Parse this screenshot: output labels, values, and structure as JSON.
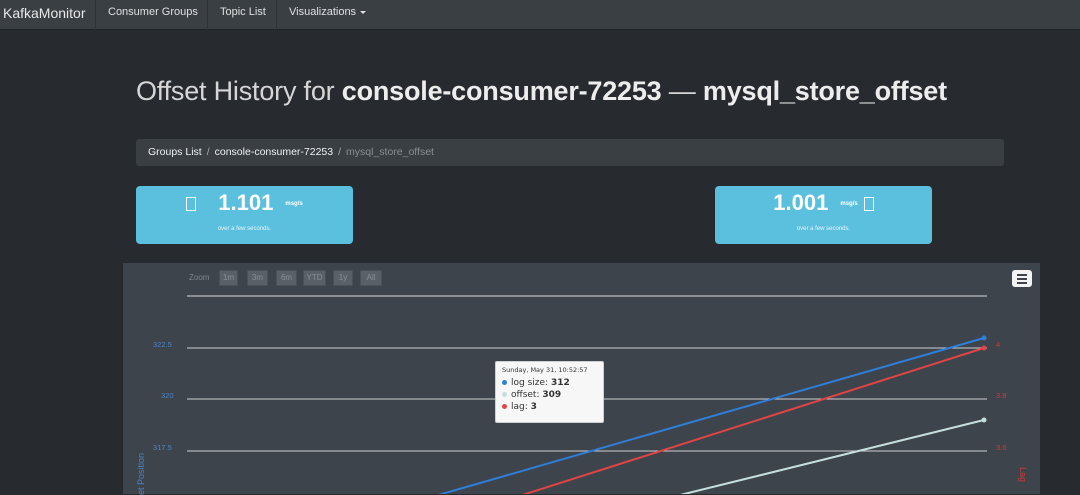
{
  "nav": {
    "brand": "KafkaMonitor",
    "items": [
      "Consumer Groups",
      "Topic List",
      "Visualizations"
    ]
  },
  "page": {
    "title_prefix": "Offset History for ",
    "title_group": "console-consumer-72253",
    "title_dash": " — ",
    "title_topic": "mysql_store_offset"
  },
  "breadcrumb": {
    "items": [
      "Groups List",
      "console-consumer-72253",
      "mysql_store_offset"
    ],
    "separator": "/"
  },
  "rates": {
    "left": {
      "value": "1.101",
      "unit": "msg/s",
      "subtitle": "over a few seconds."
    },
    "right": {
      "value": "1.001",
      "unit": "msg/s",
      "subtitle": "over a few seconds."
    }
  },
  "zoom": {
    "label": "Zoom",
    "buttons": [
      "1m",
      "3m",
      "6m",
      "YTD",
      "1y",
      "All"
    ]
  },
  "chart_data": {
    "type": "line",
    "y_left_ticks": [
      "322.5",
      "320",
      "317.5"
    ],
    "y_right_ticks": [
      "4",
      "3.8",
      "3.6"
    ],
    "y_left_title": "et Position",
    "y_right_title": "Lag",
    "series": [
      {
        "name": "log size",
        "color": "#2f7ed8",
        "axis": "left"
      },
      {
        "name": "offset",
        "color": "#c5e0dc",
        "axis": "left"
      },
      {
        "name": "lag",
        "color": "#e04444",
        "axis": "right"
      }
    ]
  },
  "tooltip": {
    "header": "Sunday, May 31, 10:52:57",
    "rows": [
      {
        "name": "log size",
        "value": "312",
        "color": "#2f7ed8"
      },
      {
        "name": "offset",
        "value": "309",
        "color": "#c5e0dc"
      },
      {
        "name": "lag",
        "value": "3",
        "color": "#e04444"
      }
    ]
  },
  "colors": {
    "accent": "#5bc0de",
    "log_size": "#2f7ed8",
    "offset": "#c5e0dc",
    "lag": "#e04444"
  }
}
